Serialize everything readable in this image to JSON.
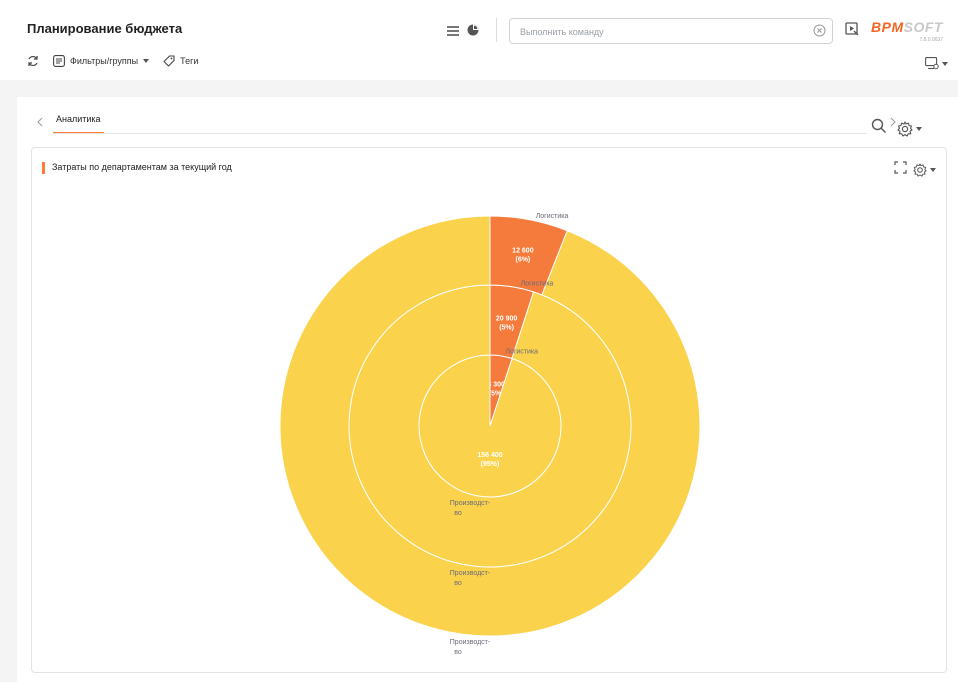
{
  "header": {
    "title": "Планирование бюджета",
    "command_placeholder": "Выполнить команду",
    "logo": {
      "part1": "BPM",
      "part2": "SOFT",
      "version": "7.8.0.0637"
    }
  },
  "toolbar": {
    "filters_label": "Фильтры/группы",
    "tags_label": "Теги"
  },
  "tabs": [
    {
      "label": "Аналитика",
      "active": true
    }
  ],
  "widget": {
    "title": "Затраты по департаментам за текущий год"
  },
  "colors": {
    "accent": "#ff7b3a",
    "production": "#fad24c",
    "logistics": "#f47b3c"
  },
  "chart_data": {
    "type": "pie",
    "title": "Затраты по департаментам за текущий год",
    "rings": [
      {
        "slices": [
          {
            "name": "Логистика",
            "value": 8300,
            "label": "8 300",
            "pct": "(5%)"
          },
          {
            "name": "Производст-во",
            "value": 156400,
            "label": "156 400",
            "pct": "(95%)"
          }
        ]
      },
      {
        "slices": [
          {
            "name": "Логистика",
            "value": 20900,
            "label": "20 900",
            "pct": "(5%)"
          },
          {
            "name": "Производст-во",
            "value": 397100,
            "label": "",
            "pct": ""
          }
        ]
      },
      {
        "slices": [
          {
            "name": "Логистика",
            "value": 12600,
            "label": "12 600",
            "pct": "(6%)"
          },
          {
            "name": "Производст-во",
            "value": 197400,
            "label": "",
            "pct": ""
          }
        ]
      }
    ],
    "category_labels": [
      {
        "ring": 0,
        "line1": "Логистика",
        "line2": ""
      },
      {
        "ring": 1,
        "line1": "Логистика",
        "line2": ""
      },
      {
        "ring": 2,
        "line1": "Логистика",
        "line2": ""
      },
      {
        "ring": 0,
        "line1": "Производст-",
        "line2": "во"
      },
      {
        "ring": 1,
        "line1": "Производст-",
        "line2": "во"
      },
      {
        "ring": 2,
        "line1": "Производст-",
        "line2": "во"
      }
    ]
  }
}
